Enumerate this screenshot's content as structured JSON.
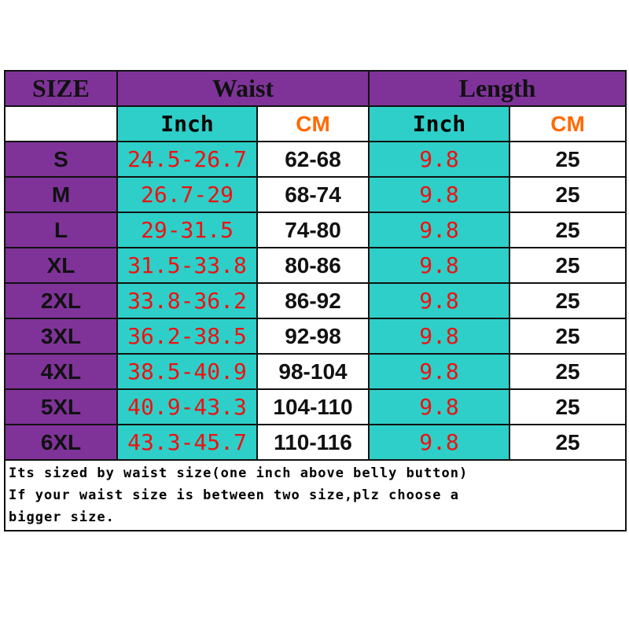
{
  "header": {
    "size": "SIZE",
    "waist": "Waist",
    "length": "Length"
  },
  "subheader": {
    "waist_inch": "Inch",
    "waist_cm": "CM",
    "length_inch": "Inch",
    "length_cm": "CM"
  },
  "rows": [
    {
      "size": "S",
      "waist_inch": "24.5-26.7",
      "waist_cm": "62-68",
      "length_inch": "9.8",
      "length_cm": "25"
    },
    {
      "size": "M",
      "waist_inch": "26.7-29",
      "waist_cm": "68-74",
      "length_inch": "9.8",
      "length_cm": "25"
    },
    {
      "size": "L",
      "waist_inch": "29-31.5",
      "waist_cm": "74-80",
      "length_inch": "9.8",
      "length_cm": "25"
    },
    {
      "size": "XL",
      "waist_inch": "31.5-33.8",
      "waist_cm": "80-86",
      "length_inch": "9.8",
      "length_cm": "25"
    },
    {
      "size": "2XL",
      "waist_inch": "33.8-36.2",
      "waist_cm": "86-92",
      "length_inch": "9.8",
      "length_cm": "25"
    },
    {
      "size": "3XL",
      "waist_inch": "36.2-38.5",
      "waist_cm": "92-98",
      "length_inch": "9.8",
      "length_cm": "25"
    },
    {
      "size": "4XL",
      "waist_inch": "38.5-40.9",
      "waist_cm": "98-104",
      "length_inch": "9.8",
      "length_cm": "25"
    },
    {
      "size": "5XL",
      "waist_inch": "40.9-43.3",
      "waist_cm": "104-110",
      "length_inch": "9.8",
      "length_cm": "25"
    },
    {
      "size": "6XL",
      "waist_inch": "43.3-45.7",
      "waist_cm": "110-116",
      "length_inch": "9.8",
      "length_cm": "25"
    }
  ],
  "note": {
    "line1": "Its sized by waist size(one inch above belly button)",
    "line2": "If your waist size is between two size,plz choose a",
    "line3": "bigger size."
  },
  "colors": {
    "purple": "#7f3399",
    "teal": "#2ecfc8",
    "red": "#ee1111",
    "orange": "#ff6a00"
  }
}
